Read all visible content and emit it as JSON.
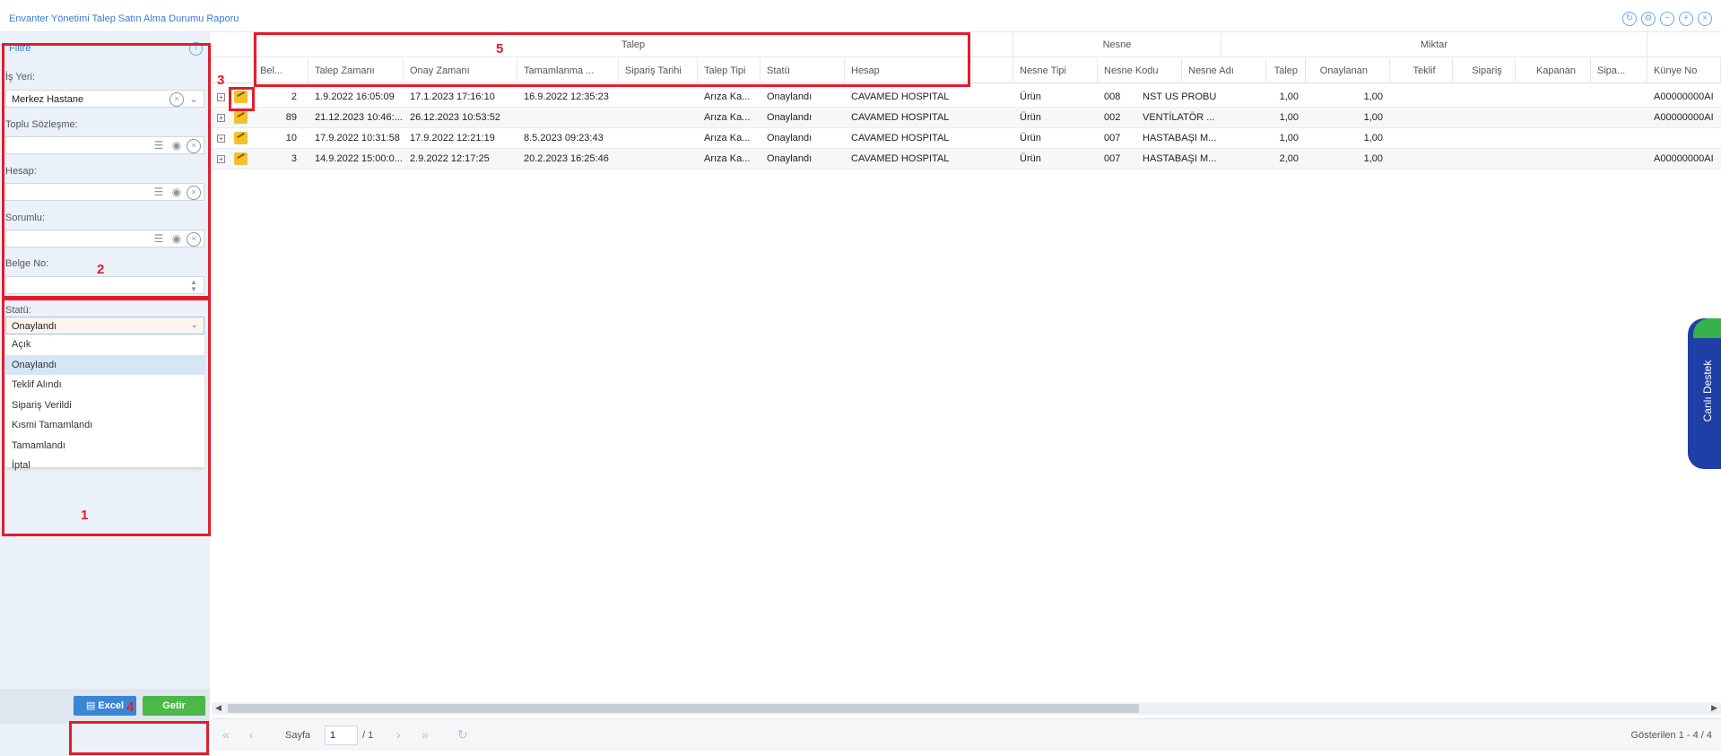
{
  "window": {
    "title": "Envanter Yönetimi Talep Satın Alma Durumu Raporu",
    "tools": [
      "refresh-icon",
      "gear-icon",
      "minimize-icon",
      "maximize-icon",
      "close-icon"
    ]
  },
  "filter": {
    "header": "Filtre",
    "is_yeri": {
      "label": "İş Yeri:",
      "value": "Merkez Hastane"
    },
    "toplu_sozlesme": {
      "label": "Toplu Sözleşme:",
      "value": ""
    },
    "hesap": {
      "label": "Hesap:",
      "value": ""
    },
    "sorumlu": {
      "label": "Sorumlu:",
      "value": ""
    },
    "belge_no": {
      "label": "Belge No:",
      "value": ""
    },
    "statu": {
      "label": "Statü:",
      "value": "Onaylandı",
      "options": [
        "Açık",
        "Onaylandı",
        "Teklif Alındı",
        "Sipariş Verildi",
        "Kısmi Tamamlandı",
        "Tamamlandı",
        "İptal"
      ]
    },
    "excel_label": "Excel",
    "getir_label": "Getir"
  },
  "annotations": [
    "1",
    "2",
    "3",
    "4",
    "5"
  ],
  "grid": {
    "groups": {
      "talep": "Talep",
      "nesne": "Nesne",
      "miktar": "Miktar"
    },
    "columns": [
      "Bel...",
      "Talep Zamanı",
      "Onay Zamanı",
      "Tamamlanma ...",
      "Sipariş Tarihi",
      "Talep Tipi",
      "Statü",
      "Hesap",
      "Nesne Tipi",
      "Nesne Kodu",
      "Nesne Adı",
      "Talep",
      "Onaylanan",
      "Teklif",
      "Sipariş",
      "Kapanan",
      "Sipa...",
      "Künye No"
    ],
    "rows": [
      [
        "2",
        "1.9.2022 16:05:09",
        "17.1.2023 17:16:10",
        "16.9.2022 12:35:23",
        "",
        "Arıza Ka...",
        "Onaylandı",
        "CAVAMED HOSPITAL",
        "Ürün",
        "008",
        "NST US PROBU",
        "1,00",
        "1,00",
        "",
        "",
        "",
        "",
        "A00000000AI"
      ],
      [
        "89",
        "21.12.2023 10:46:...",
        "26.12.2023 10:53:52",
        "",
        "",
        "Arıza Ka...",
        "Onaylandı",
        "CAVAMED HOSPITAL",
        "Ürün",
        "002",
        "VENTİLATÖR ...",
        "1,00",
        "1,00",
        "",
        "",
        "",
        "",
        "A00000000AI"
      ],
      [
        "10",
        "17.9.2022 10:31:58",
        "17.9.2022 12:21:19",
        "8.5.2023 09:23:43",
        "",
        "Arıza Ka...",
        "Onaylandı",
        "CAVAMED HOSPITAL",
        "Ürün",
        "007",
        "HASTABAŞI M...",
        "1,00",
        "1,00",
        "",
        "",
        "",
        "",
        ""
      ],
      [
        "3",
        "14.9.2022 15:00:0...",
        "2.9.2022 12:17:25",
        "20.2.2023 16:25:46",
        "",
        "Arıza Ka...",
        "Onaylandı",
        "CAVAMED HOSPITAL",
        "Ürün",
        "007",
        "HASTABAŞI M...",
        "2,00",
        "1,00",
        "",
        "",
        "",
        "",
        "A00000000AI"
      ]
    ]
  },
  "pager": {
    "sayfa_label": "Sayfa",
    "page": "1",
    "total": "/ 1",
    "info": "Gösterilen 1 - 4 / 4"
  },
  "support": {
    "label": "Canlı Destek"
  },
  "colors": {
    "accent": "#3a7bd5",
    "annotation": "#e21d2b",
    "excel": "#3a86d6",
    "getir": "#4cb848"
  }
}
